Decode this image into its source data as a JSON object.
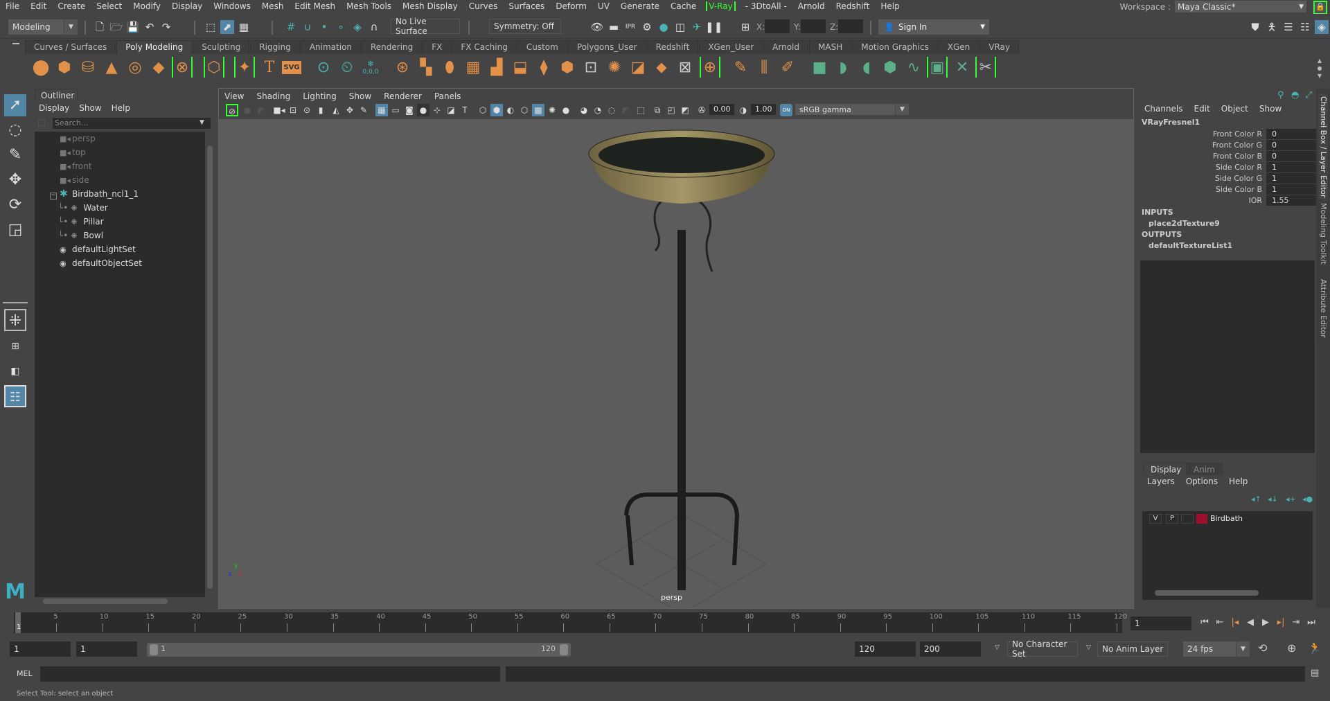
{
  "menubar": {
    "items": [
      "File",
      "Edit",
      "Create",
      "Select",
      "Modify",
      "Display",
      "Windows",
      "Mesh",
      "Edit Mesh",
      "Mesh Tools",
      "Mesh Display",
      "Curves",
      "Surfaces",
      "Deform",
      "UV",
      "Generate",
      "Cache"
    ],
    "vray": "V-Ray",
    "items2": [
      "- 3DtoAll -",
      "Arnold",
      "Redshift",
      "Help"
    ],
    "workspace_label": "Workspace :",
    "workspace_value": "Maya Classic*"
  },
  "statusline": {
    "menuset": "Modeling",
    "live_surface": "No Live Surface",
    "symmetry": "Symmetry: Off",
    "x_label": "X:",
    "y_label": "Y:",
    "z_label": "Z:",
    "signin": "Sign In"
  },
  "shelf": {
    "tabs": [
      "Curves / Surfaces",
      "Poly Modeling",
      "Sculpting",
      "Rigging",
      "Animation",
      "Rendering",
      "FX",
      "FX Caching",
      "Custom",
      "Polygons_User",
      "Redshift",
      "XGen_User",
      "Arnold",
      "MASH",
      "Motion Graphics",
      "XGen",
      "VRay"
    ],
    "active_tab": "Poly Modeling",
    "svg_label": "SVG",
    "text_label": "T",
    "coord_label": "0,0,0"
  },
  "outliner": {
    "title": "Outliner",
    "menu": [
      "Display",
      "Show",
      "Help"
    ],
    "search_placeholder": "Search...",
    "items": [
      {
        "label": "persp",
        "type": "camera",
        "dim": true
      },
      {
        "label": "top",
        "type": "camera",
        "dim": true
      },
      {
        "label": "front",
        "type": "camera",
        "dim": true
      },
      {
        "label": "side",
        "type": "camera",
        "dim": true
      },
      {
        "label": "Birdbath_ncl1_1",
        "type": "group",
        "expanded": true
      },
      {
        "label": "Water",
        "type": "mesh",
        "child": true
      },
      {
        "label": "Pillar",
        "type": "mesh",
        "child": true
      },
      {
        "label": "Bowl",
        "type": "mesh",
        "child": true
      },
      {
        "label": "defaultLightSet",
        "type": "set"
      },
      {
        "label": "defaultObjectSet",
        "type": "set"
      }
    ]
  },
  "viewport": {
    "menu": [
      "View",
      "Shading",
      "Lighting",
      "Show",
      "Renderer",
      "Panels"
    ],
    "exposure": "0.00",
    "gamma": "1.00",
    "color_mgmt_on": "ON",
    "colorspace": "sRGB gamma",
    "camera_label": "persp",
    "axis": {
      "x": "x",
      "y": "y",
      "z": "z"
    }
  },
  "channelbox": {
    "menu": [
      "Channels",
      "Edit",
      "Object",
      "Show"
    ],
    "node": "VRayFresnel1",
    "attrs": [
      {
        "label": "Front Color R",
        "value": "0"
      },
      {
        "label": "Front Color G",
        "value": "0"
      },
      {
        "label": "Front Color B",
        "value": "0"
      },
      {
        "label": "Side Color R",
        "value": "1"
      },
      {
        "label": "Side Color G",
        "value": "1"
      },
      {
        "label": "Side Color B",
        "value": "1"
      },
      {
        "label": "IOR",
        "value": "1.55"
      }
    ],
    "inputs_label": "INPUTS",
    "input_node": "place2dTexture9",
    "outputs_label": "OUTPUTS",
    "output_node": "defaultTextureList1"
  },
  "layereditor": {
    "tabs": [
      "Display",
      "Anim"
    ],
    "active_tab": "Display",
    "menu": [
      "Layers",
      "Options",
      "Help"
    ],
    "layers": [
      {
        "v": "V",
        "p": "P",
        "name": "Birdbath",
        "color": "#9e0f2e"
      }
    ]
  },
  "sidetabs": [
    "Channel Box / Layer Editor",
    "Modeling Toolkit",
    "Attribute Editor"
  ],
  "timeslider": {
    "ticks": [
      5,
      10,
      15,
      20,
      25,
      30,
      35,
      40,
      45,
      50,
      55,
      60,
      65,
      70,
      75,
      80,
      85,
      90,
      95,
      100,
      105,
      110,
      115,
      120
    ],
    "start": 1,
    "end": 120,
    "current": "1",
    "current_frame_field": "1"
  },
  "range": {
    "start_time": "1",
    "playback_start": "1",
    "range_start_label": "1",
    "range_end_label": "120",
    "playback_end": "120",
    "end_time": "200",
    "character_set": "No Character Set",
    "anim_layer": "No Anim Layer",
    "fps": "24 fps"
  },
  "cmdline": {
    "label": "MEL"
  },
  "helpline": {
    "text": "Select Tool: select an object"
  }
}
